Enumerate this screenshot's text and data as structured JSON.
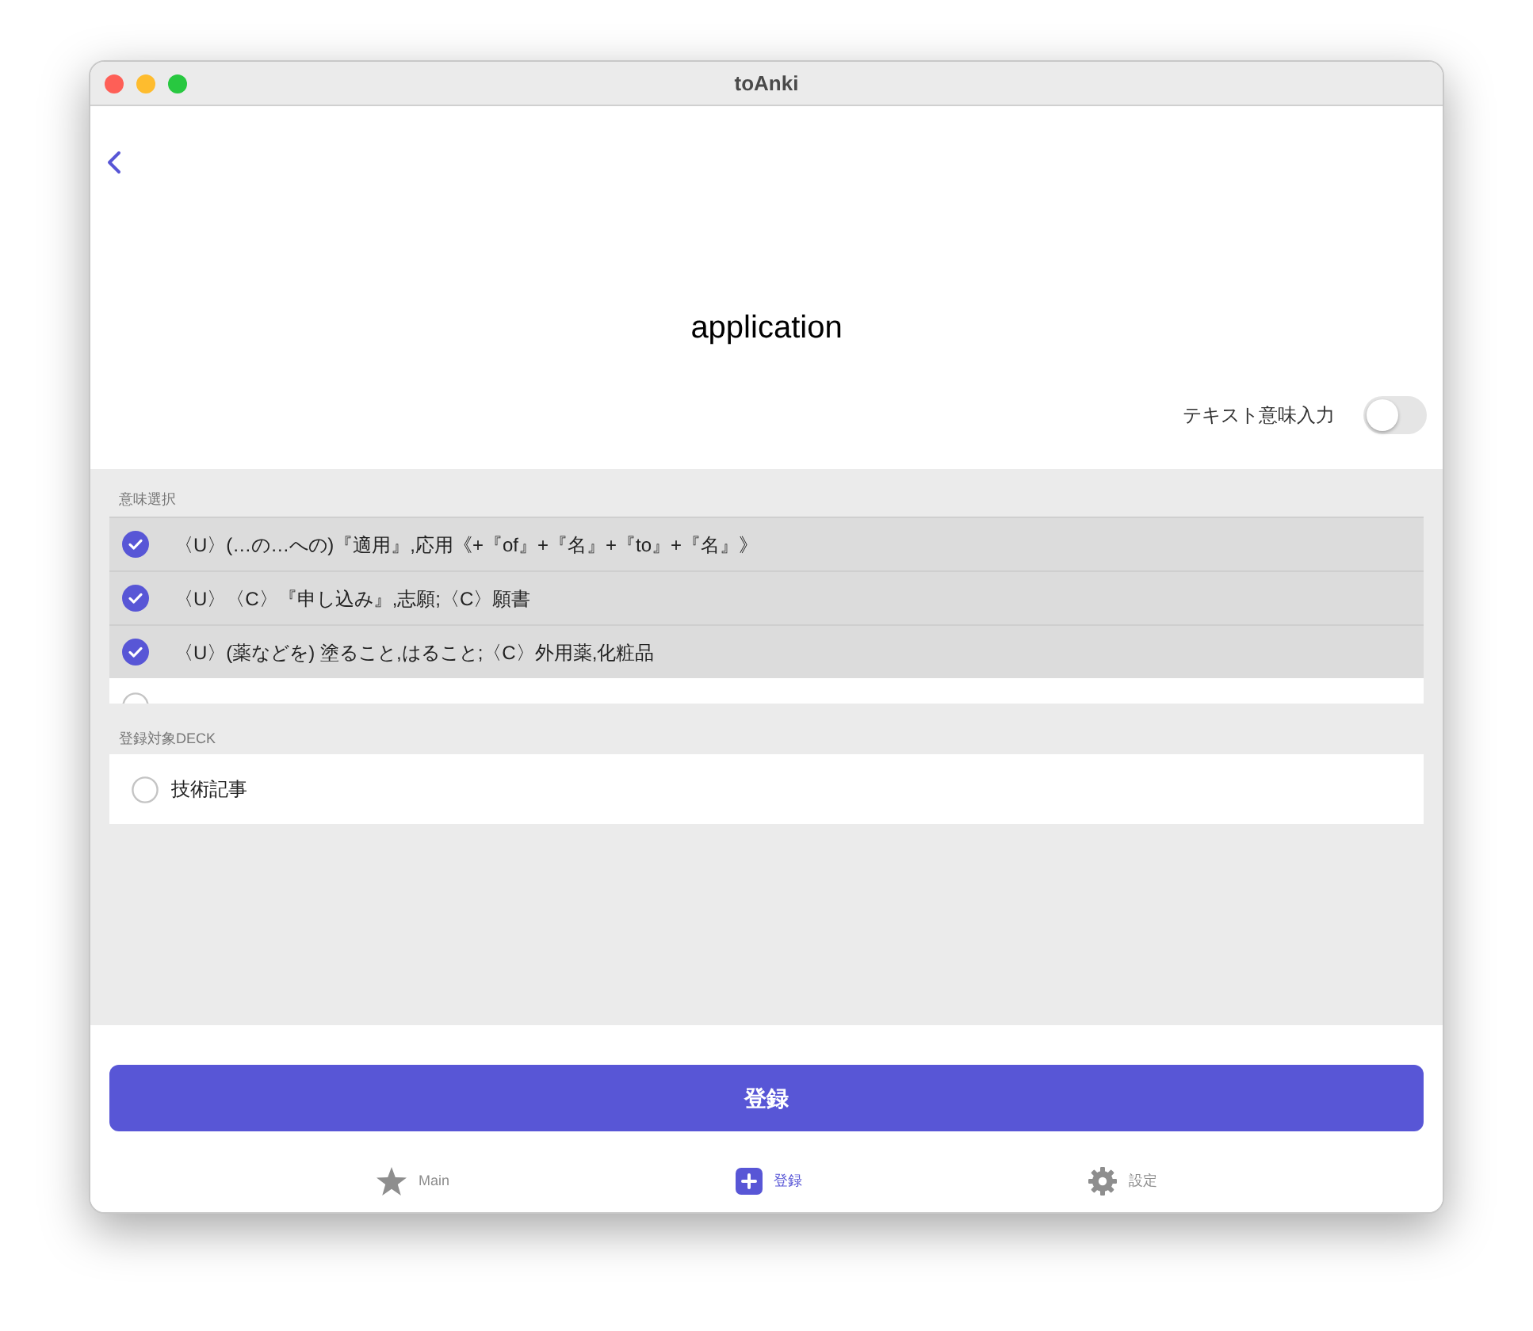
{
  "window": {
    "title": "toAnki"
  },
  "word": "application",
  "text_input_toggle": {
    "label": "テキスト意味入力",
    "on": false
  },
  "meanings": {
    "header": "意味選択",
    "items": [
      {
        "text": "〈U〉(…の…への)『適用』,応用《+『of』+『名』+『to』+『名』》",
        "checked": true
      },
      {
        "text": "〈U〉〈C〉『申し込み』,志願;〈C〉願書",
        "checked": true
      },
      {
        "text": "〈U〉(薬などを) 塗ること,はること;〈C〉外用薬,化粧品",
        "checked": true
      },
      {
        "checked": false
      }
    ]
  },
  "decks": {
    "header": "登録対象DECK",
    "items": [
      {
        "text": "技術記事",
        "selected": false
      }
    ]
  },
  "register_button": "登録",
  "tabs": [
    {
      "label": "Main",
      "kind": "star",
      "selected": false
    },
    {
      "label": "登録",
      "kind": "plus",
      "selected": true
    },
    {
      "label": "設定",
      "kind": "gear",
      "selected": false
    }
  ]
}
